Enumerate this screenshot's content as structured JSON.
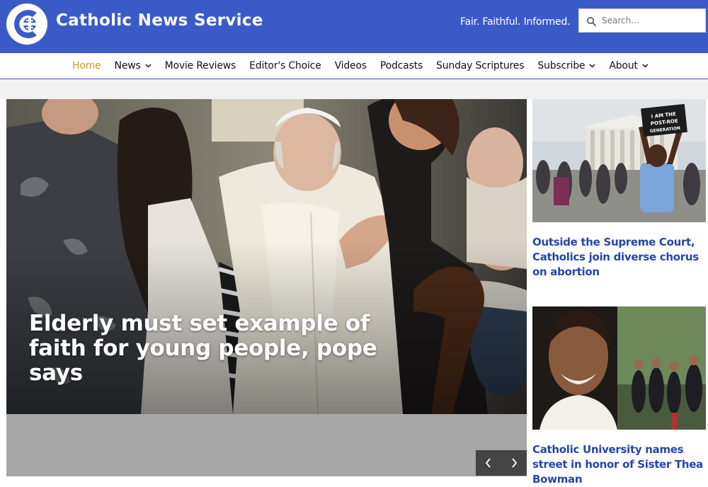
{
  "header": {
    "site_title": "Catholic News Service",
    "tagline": "Fair. Faithful. Informed.",
    "search_placeholder": "Search...",
    "brand_color": "#3a5bc7",
    "logo_icon": "cross-c-logo-icon",
    "search_icon": "search-icon"
  },
  "nav": {
    "items": [
      {
        "label": "Home",
        "active": true,
        "has_dropdown": false
      },
      {
        "label": "News",
        "active": false,
        "has_dropdown": true
      },
      {
        "label": "Movie Reviews",
        "active": false,
        "has_dropdown": false
      },
      {
        "label": "Editor's Choice",
        "active": false,
        "has_dropdown": false
      },
      {
        "label": "Videos",
        "active": false,
        "has_dropdown": false
      },
      {
        "label": "Podcasts",
        "active": false,
        "has_dropdown": false
      },
      {
        "label": "Sunday Scriptures",
        "active": false,
        "has_dropdown": false
      },
      {
        "label": "Subscribe",
        "active": false,
        "has_dropdown": true
      },
      {
        "label": "About",
        "active": false,
        "has_dropdown": true
      }
    ],
    "active_color": "#d19a1e"
  },
  "hero": {
    "headline": "Elderly must set example of faith for young people, pope says",
    "prev_icon": "chevron-left-icon",
    "next_icon": "chevron-right-icon"
  },
  "sidebar": {
    "stories": [
      {
        "headline": "Outside the Supreme Court, Catholics join diverse chorus on abortion",
        "sign_text": "I AM THE POST-ROE GENERATION"
      },
      {
        "headline": "Catholic University names street in honor of Sister Thea Bowman"
      }
    ],
    "headline_color": "#2446a8"
  }
}
